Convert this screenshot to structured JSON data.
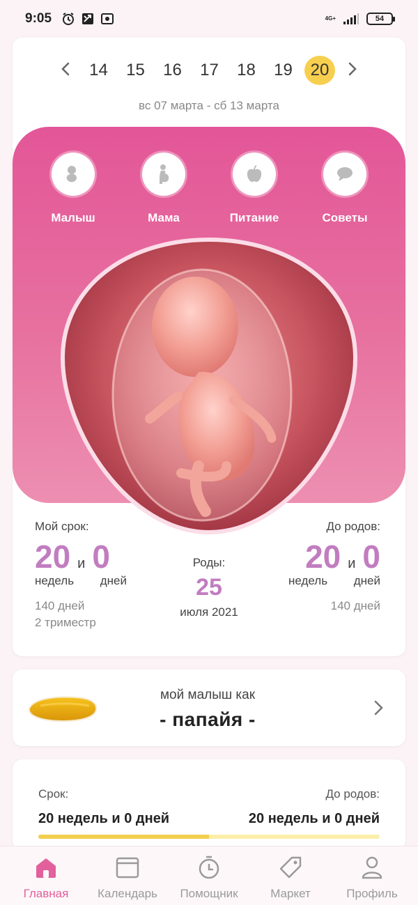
{
  "status_bar": {
    "time": "9:05",
    "network": "4G+",
    "battery": "54"
  },
  "week_nav": {
    "weeks": [
      "14",
      "15",
      "16",
      "17",
      "18",
      "19",
      "20"
    ],
    "active_week": "20",
    "date_range": "вс 07 марта - сб 13 марта"
  },
  "quick_links": [
    {
      "label": "Малыш",
      "icon": "baby-icon"
    },
    {
      "label": "Мама",
      "icon": "pregnant-woman-icon"
    },
    {
      "label": "Питание",
      "icon": "apple-icon"
    },
    {
      "label": "Советы",
      "icon": "chat-bubble-icon"
    }
  ],
  "stats": {
    "my_term": {
      "title": "Мой срок:",
      "weeks": "20",
      "and": "и",
      "days": "0",
      "weeks_unit": "недель",
      "days_unit": "дней",
      "total_days": "140 дней",
      "trimester": "2 триместр"
    },
    "birth": {
      "title": "Роды:",
      "day": "25",
      "month_year": "июля 2021"
    },
    "until_birth": {
      "title": "До родов:",
      "weeks": "20",
      "and": "и",
      "days": "0",
      "weeks_unit": "недель",
      "days_unit": "дней",
      "total_days": "140 дней"
    }
  },
  "fruit_card": {
    "caption": "мой малыш как",
    "fruit": "- папайя -"
  },
  "summary": {
    "left_label": "Срок:",
    "left_value": "20 недель и 0 дней",
    "right_label": "До родов:",
    "right_value": "20 недель и 0 дней",
    "progress": 0.5
  },
  "bottom_nav": [
    {
      "label": "Главная",
      "icon": "home-icon",
      "active": true
    },
    {
      "label": "Календарь",
      "icon": "calendar-icon",
      "active": false
    },
    {
      "label": "Помощник",
      "icon": "timer-icon",
      "active": false
    },
    {
      "label": "Маркет",
      "icon": "tag-icon",
      "active": false
    },
    {
      "label": "Профиль",
      "icon": "profile-icon",
      "active": false
    }
  ],
  "colors": {
    "accent_pink": "#e35698",
    "accent_purple": "#c17dc0",
    "highlight_yellow": "#f7cf4f"
  }
}
